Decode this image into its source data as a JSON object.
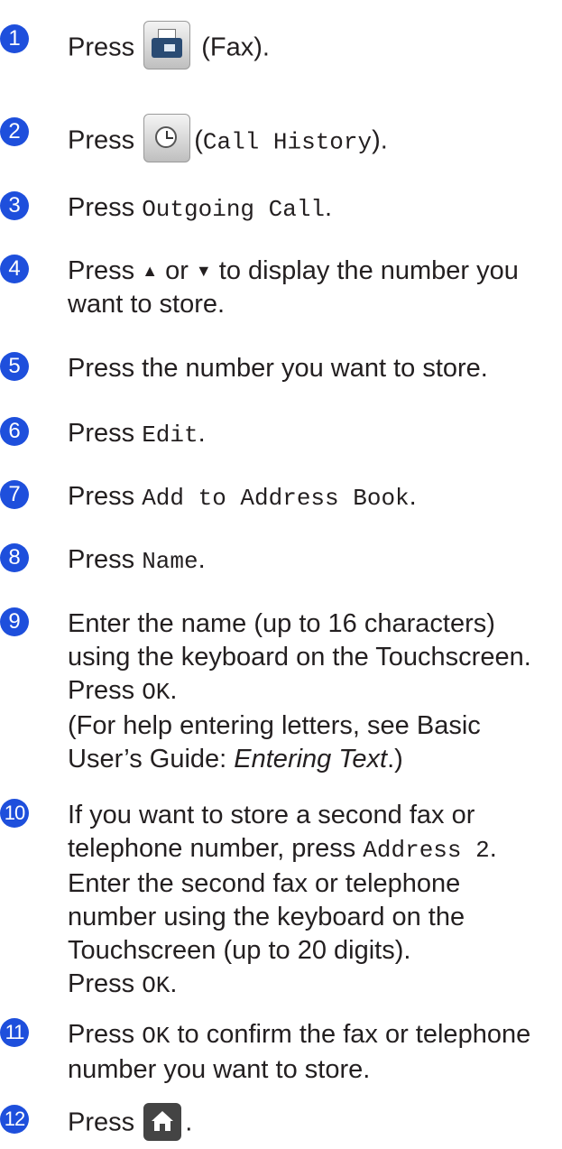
{
  "steps": [
    {
      "num": "1",
      "press": "Press",
      "suffix": "(Fax).",
      "icon": "fax-icon"
    },
    {
      "num": "2",
      "press": "Press",
      "suffix_open": "(",
      "suffix_mono": "Call History",
      "suffix_close": ").",
      "icon": "clock-icon"
    },
    {
      "num": "3",
      "press": "Press",
      "mono": "Outgoing Call",
      "end": "."
    },
    {
      "num": "4",
      "line1a": "Press ",
      "up": "▲",
      "mid": " or ",
      "down": "▼",
      "line1b": " to display the number you",
      "line2": "want to store."
    },
    {
      "num": "5",
      "text": "Press the number you want to store."
    },
    {
      "num": "6",
      "press": "Press",
      "mono": "Edit",
      "end": "."
    },
    {
      "num": "7",
      "press": "Press",
      "mono": "Add to Address Book",
      "end": "."
    },
    {
      "num": "8",
      "press": "Press",
      "mono": "Name",
      "end": "."
    },
    {
      "num": "9",
      "line1": "Enter the name (up to 16 characters)",
      "line2": "using the keyboard on the Touchscreen.",
      "press": "Press",
      "mono": "OK",
      "end": ".",
      "line4": "(For help entering letters, see Basic",
      "line5a": "User’s Guide: ",
      "line5i": "Entering Text",
      "line5b": ".)"
    },
    {
      "num": "10",
      "line1": "If you want to store a second fax or",
      "line2a": "telephone number, press ",
      "line2m": "Address 2",
      "line2b": ".",
      "line3": "Enter the second fax or telephone",
      "line4": "number using the keyboard on the",
      "line5": "Touchscreen (up to 20 digits).",
      "press": "Press",
      "mono": "OK",
      "end": "."
    },
    {
      "num": "11",
      "press": "Press",
      "mono": "OK",
      "line1b": " to confirm the fax or telephone",
      "line2": "number you want to store."
    },
    {
      "num": "12",
      "press": "Press",
      "end": ".",
      "icon": "home-icon"
    }
  ]
}
